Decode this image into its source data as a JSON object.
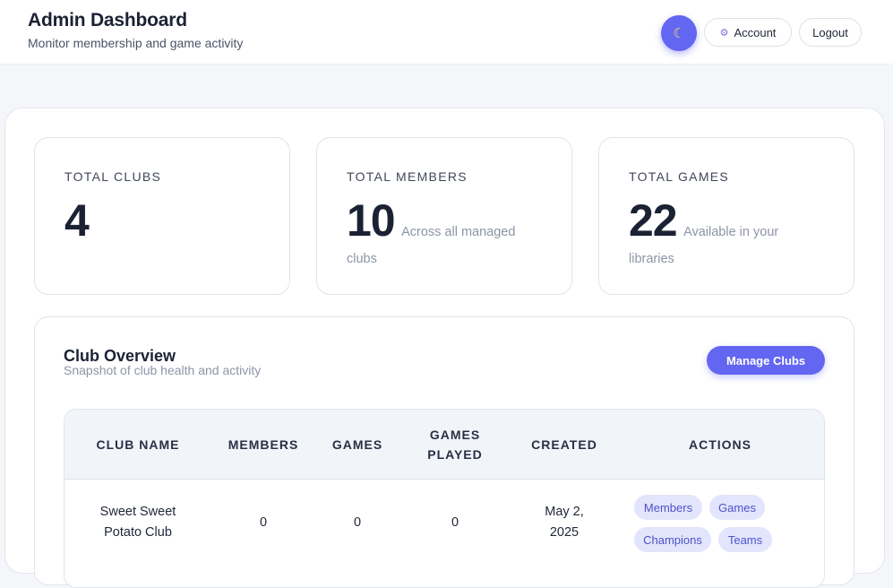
{
  "header": {
    "title": "Admin Dashboard",
    "subtitle": "Monitor membership and game activity",
    "theme_icon": "moon-icon",
    "account_label": "Account",
    "account_icon": "gear-icon",
    "logout_label": "Logout"
  },
  "stats": [
    {
      "label": "TOTAL CLUBS",
      "value": "4",
      "note": ""
    },
    {
      "label": "TOTAL MEMBERS",
      "value": "10",
      "note": "Across all managed clubs"
    },
    {
      "label": "TOTAL GAMES",
      "value": "22",
      "note": "Available in your libraries"
    }
  ],
  "overview": {
    "title": "Club Overview",
    "subtitle": "Snapshot of club health and activity",
    "manage_label": "Manage Clubs",
    "columns": [
      "CLUB NAME",
      "MEMBERS",
      "GAMES",
      "GAMES PLAYED",
      "CREATED",
      "ACTIONS"
    ],
    "rows": [
      {
        "club_name": "Sweet Sweet Potato Club",
        "members": "0",
        "games": "0",
        "games_played": "0",
        "created": "May 2, 2025",
        "actions": [
          "Members",
          "Games",
          "Champions",
          "Teams"
        ]
      }
    ]
  },
  "colors": {
    "accent": "#6366f1",
    "tag_bg": "#e2e5fb",
    "tag_text": "#4e52c9",
    "heading": "#1b2233",
    "muted": "#8d95a6"
  }
}
